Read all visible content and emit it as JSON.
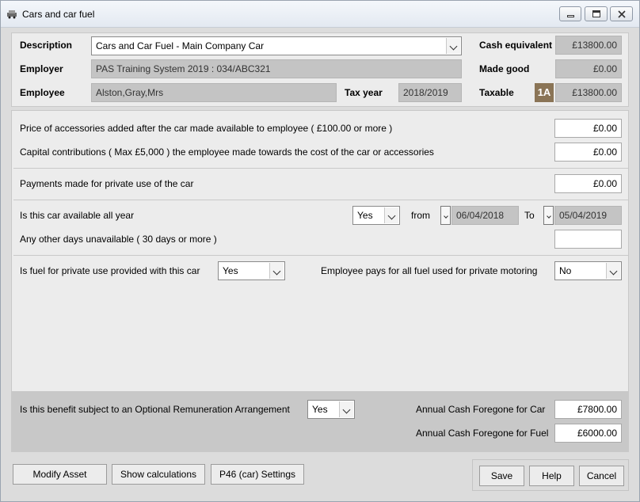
{
  "window": {
    "title": "Cars and car fuel"
  },
  "header": {
    "description_label": "Description",
    "description_value": "Cars and Car Fuel - Main Company Car",
    "employer_label": "Employer",
    "employer_value": "PAS Training System 2019 : 034/ABC321",
    "employee_label": "Employee",
    "employee_value": "Alston,Gray,Mrs",
    "tax_year_label": "Tax year",
    "tax_year_value": "2018/2019",
    "cash_equiv_label": "Cash equivalent",
    "cash_equiv_value": "£13800.00",
    "made_good_label": "Made good",
    "made_good_value": "£0.00",
    "taxable_label": "Taxable",
    "taxable_badge": "1A",
    "taxable_value": "£13800.00"
  },
  "accessories": {
    "label": "Price of accessories added after the car made available to employee ( £100.00 or  more )",
    "value": "£0.00"
  },
  "capital": {
    "label": "Capital contributions ( Max £5,000 ) the employee made towards the cost of the car or accessories",
    "value": "£0.00"
  },
  "payments": {
    "label": "Payments made for private use of the car",
    "value": "£0.00"
  },
  "availability": {
    "label": "Is this car available all year",
    "value": "Yes",
    "from_label": "from",
    "from_date": "06/04/2018",
    "to_label": "To",
    "to_date": "05/04/2019",
    "unavailable_label": "Any other days unavailable ( 30 days or more )",
    "unavailable_value": ""
  },
  "fuel": {
    "label": "Is fuel for private use provided with this car",
    "value": "Yes",
    "pays_label": "Employee pays for all fuel used for private motoring",
    "pays_value": "No"
  },
  "ora": {
    "label": "Is this benefit subject to an Optional Remuneration Arrangement",
    "value": "Yes",
    "car_label": "Annual Cash Foregone for Car",
    "car_value": "£7800.00",
    "fuel_label": "Annual Cash Foregone for Fuel",
    "fuel_value": "£6000.00"
  },
  "buttons": {
    "modify": "Modify Asset",
    "show_calc": "Show calculations",
    "p46": "P46 (car) Settings",
    "save": "Save",
    "help": "Help",
    "cancel": "Cancel"
  }
}
